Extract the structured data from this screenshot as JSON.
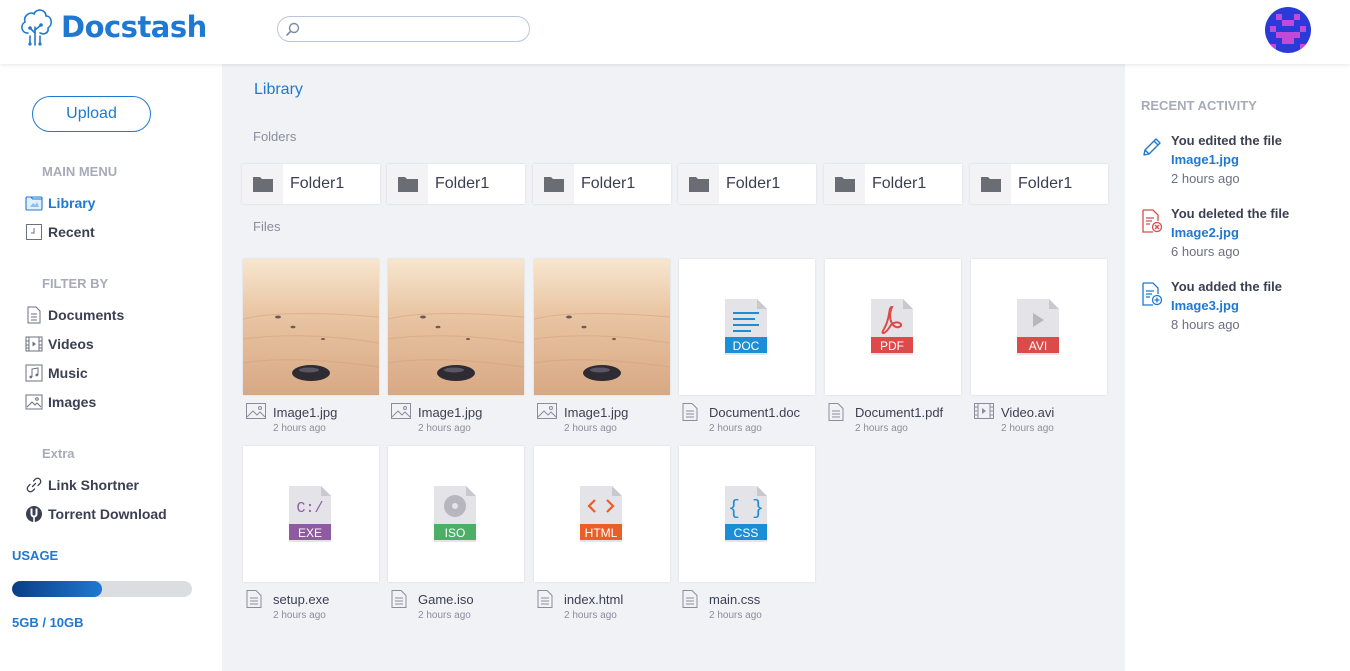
{
  "app": {
    "name": "Docstash"
  },
  "header": {
    "search": {
      "placeholder": "",
      "value": ""
    }
  },
  "sidebar": {
    "upload_label": "Upload",
    "main_menu_heading": "MAIN MENU",
    "main_menu": [
      {
        "label": "Library",
        "icon": "library-icon",
        "active": true
      },
      {
        "label": "Recent",
        "icon": "recent-icon"
      }
    ],
    "filter_heading": "FILTER BY",
    "filters": [
      {
        "label": "Documents",
        "icon": "document-icon"
      },
      {
        "label": "Videos",
        "icon": "video-icon"
      },
      {
        "label": "Music",
        "icon": "music-icon"
      },
      {
        "label": "Images",
        "icon": "image-icon"
      }
    ],
    "extra_heading": "Extra",
    "extra": [
      {
        "label": "Link Shortner",
        "icon": "link-icon"
      },
      {
        "label": "Torrent Download",
        "icon": "torrent-icon"
      }
    ],
    "usage": {
      "heading": "USAGE",
      "text": "5GB / 10GB",
      "used_fraction": 0.5
    }
  },
  "main": {
    "breadcrumb": "Library",
    "folders_heading": "Folders",
    "folders": [
      {
        "label": "Folder1"
      },
      {
        "label": "Folder1"
      },
      {
        "label": "Folder1"
      },
      {
        "label": "Folder1"
      },
      {
        "label": "Folder1"
      },
      {
        "label": "Folder1"
      }
    ],
    "files_heading": "Files",
    "files": [
      {
        "name": "Image1.jpg",
        "time": "2 hours ago",
        "kind": "image"
      },
      {
        "name": "Image1.jpg",
        "time": "2 hours ago",
        "kind": "image"
      },
      {
        "name": "Image1.jpg",
        "time": "2 hours ago",
        "kind": "image"
      },
      {
        "name": "Document1.doc",
        "time": "2 hours ago",
        "kind": "doc",
        "badge": "DOC",
        "color": "#1b8fd6"
      },
      {
        "name": "Document1.pdf",
        "time": "2 hours ago",
        "kind": "pdf",
        "badge": "PDF",
        "color": "#dc4a4a"
      },
      {
        "name": "Video.avi",
        "time": "2 hours ago",
        "kind": "video",
        "badge": "AVI",
        "color": "#dc4a4a"
      },
      {
        "name": "setup.exe",
        "time": "2 hours ago",
        "kind": "exe",
        "badge": "EXE",
        "color": "#8e5aa2"
      },
      {
        "name": "Game.iso",
        "time": "2 hours ago",
        "kind": "iso",
        "badge": "ISO",
        "color": "#4caf66"
      },
      {
        "name": "index.html",
        "time": "2 hours ago",
        "kind": "html",
        "badge": "HTML",
        "color": "#eb5e28"
      },
      {
        "name": "main.css",
        "time": "2 hours ago",
        "kind": "css",
        "badge": "CSS",
        "color": "#1b8fd6"
      }
    ]
  },
  "activity": {
    "heading": "RECENT ACTIVITY",
    "items": [
      {
        "action": "You edited the file",
        "file": "Image1.jpg",
        "time": "2 hours ago",
        "icon": "pencil-icon",
        "color": "#1f78d1"
      },
      {
        "action": "You deleted the file",
        "file": "Image2.jpg",
        "time": "6 hours ago",
        "icon": "file-delete-icon",
        "color": "#dc4a4a"
      },
      {
        "action": "You added the file",
        "file": "Image3.jpg",
        "time": "8 hours ago",
        "icon": "file-add-icon",
        "color": "#1f78d1"
      }
    ]
  }
}
